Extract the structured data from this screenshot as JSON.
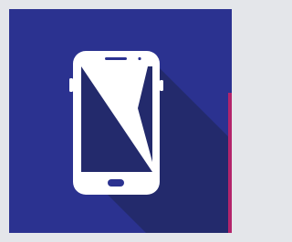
{
  "icon": {
    "name": "smartphone-icon",
    "colors": {
      "frame_background": "#e4e6ea",
      "tile_background": "#2b3290",
      "long_shadow": "#232a6c",
      "phone_body": "#ffffff",
      "screen_dark": "#232a6c",
      "accent_stripe": "#b3246b"
    }
  }
}
